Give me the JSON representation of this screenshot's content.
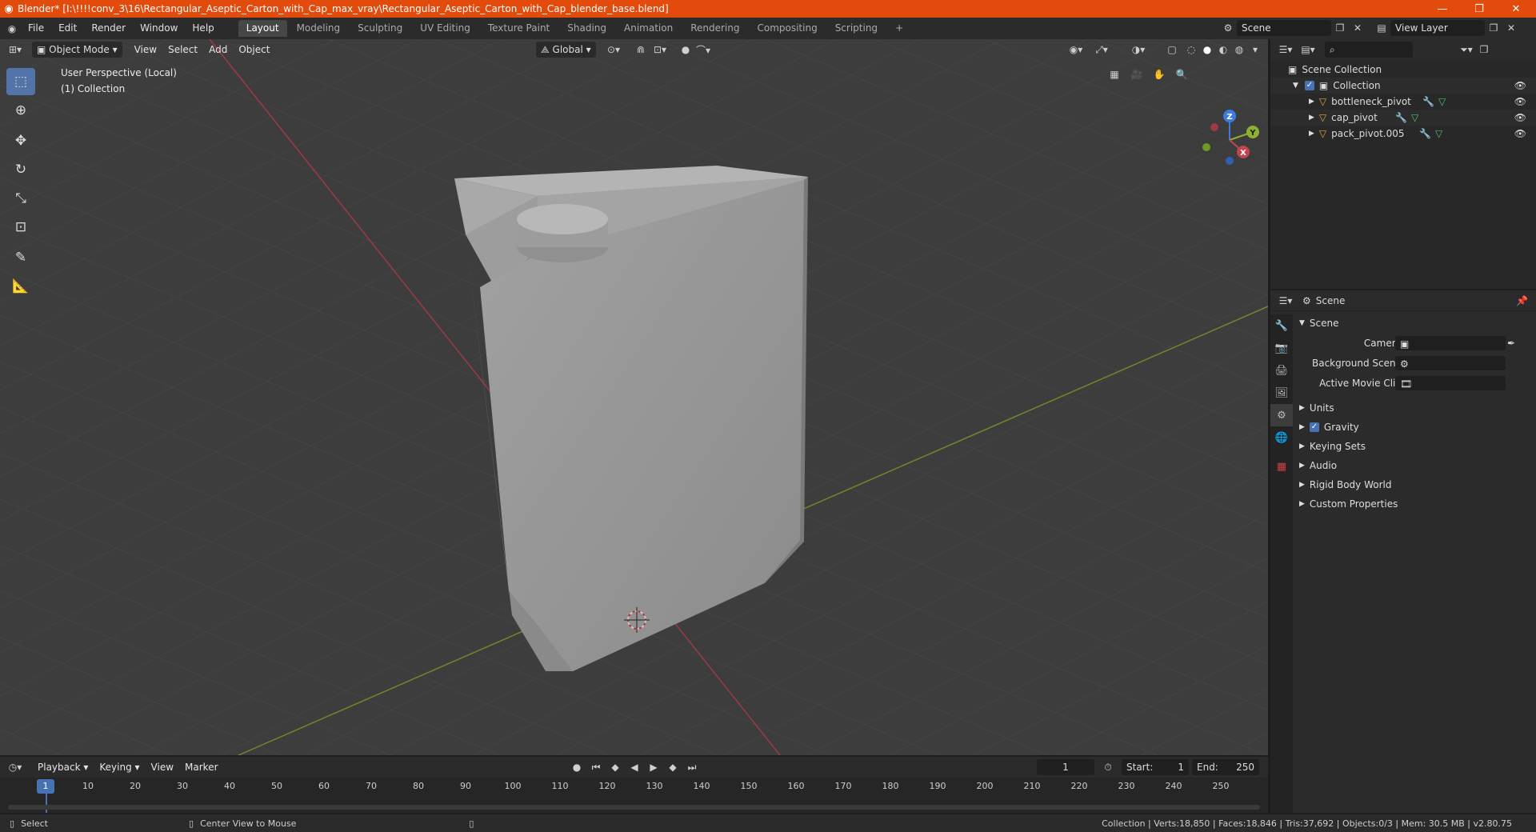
{
  "window": {
    "title": "Blender* [I:\\!!!!conv_3\\16\\Rectangular_Aseptic_Carton_with_Cap_max_vray\\Rectangular_Aseptic_Carton_with_Cap_blender_base.blend]",
    "minimize": "—",
    "maximize": "❐",
    "close": "✕"
  },
  "menu": [
    "File",
    "Edit",
    "Render",
    "Window",
    "Help"
  ],
  "workspaces": [
    "Layout",
    "Modeling",
    "Sculpting",
    "UV Editing",
    "Texture Paint",
    "Shading",
    "Animation",
    "Rendering",
    "Compositing",
    "Scripting"
  ],
  "add_workspace": "+",
  "scene_field": "Scene",
  "view_layer_field": "View Layer",
  "viewport": {
    "mode": "Object Mode",
    "menus": [
      "View",
      "Select",
      "Add",
      "Object"
    ],
    "transform": "Global",
    "perspective_label": "User Perspective (Local)",
    "collection_label": "(1) Collection",
    "gizmo": {
      "x": "X",
      "y": "Y",
      "z": "Z"
    }
  },
  "outliner": {
    "scene_collection": "Scene Collection",
    "collection": "Collection",
    "objects": [
      "bottleneck_pivot",
      "cap_pivot",
      "pack_pivot.005"
    ]
  },
  "properties": {
    "context": "Scene",
    "panel": "Scene",
    "camera_label": "Camera",
    "bg_scene_label": "Background Scene",
    "movie_clip_label": "Active Movie Clip",
    "sections": [
      "Units",
      "Gravity",
      "Keying Sets",
      "Audio",
      "Rigid Body World",
      "Custom Properties"
    ]
  },
  "timeline": {
    "menus": [
      "Playback",
      "Keying",
      "View",
      "Marker"
    ],
    "current_frame": "1",
    "start_label": "Start:",
    "start": "1",
    "end_label": "End:",
    "end": "250",
    "playhead": "1",
    "ticks": [
      "10",
      "20",
      "30",
      "40",
      "50",
      "60",
      "70",
      "80",
      "90",
      "100",
      "110",
      "120",
      "130",
      "140",
      "150",
      "160",
      "170",
      "180",
      "190",
      "200",
      "210",
      "220",
      "230",
      "240",
      "250"
    ]
  },
  "status": {
    "left_action": "Select",
    "middle_action": "Center View to Mouse",
    "stats": "Collection | Verts:18,850 | Faces:18,846 | Tris:37,692 | Objects:0/3 | Mem: 30.5 MB | v2.80.75"
  },
  "colors": {
    "title_bar": "#e24b0c",
    "viewport_bg": "#3d3d3d",
    "accent": "#4772b3",
    "x_axis": "#c2444f",
    "y_axis": "#8cb031",
    "z_axis": "#3d7bde"
  }
}
